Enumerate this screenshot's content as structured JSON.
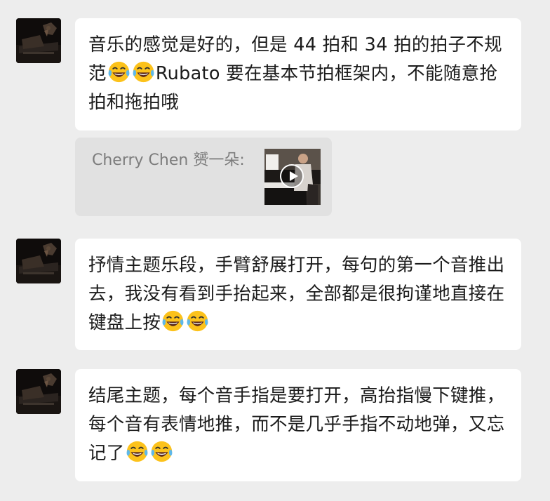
{
  "messages": [
    {
      "id": "msg1",
      "avatar_icon": "avatar-piano-photo-icon",
      "text_before": "音乐的感觉是好的，但是 44 拍和 34 拍的拍子不规范",
      "emoji_icon": "tears-of-joy-emoji-icon",
      "emoji_count": 2,
      "text_after": "Rubato 要在基本节拍框架内，不能随意抢拍和拖拍哦"
    },
    {
      "id": "msg2",
      "avatar_icon": "avatar-piano-photo-icon",
      "text_before": "抒情主题乐段，手臂舒展打开，每句的第一个音推出去，我没有看到手抬起来，全部都是很拘谨地直接在键盘上按",
      "emoji_icon": "tears-of-joy-emoji-icon",
      "emoji_count": 2,
      "text_after": ""
    },
    {
      "id": "msg3",
      "avatar_icon": "avatar-piano-photo-icon",
      "text_before": "结尾主题，每个音手指是要打开，高抬指慢下键推，每个音有表情地推，而不是几乎手指不动地弹，又忘记了",
      "emoji_icon": "tears-of-joy-emoji-icon",
      "emoji_count": 2,
      "text_after": ""
    }
  ],
  "quote": {
    "text": "Cherry Chen 赟一朵:",
    "thumbnail_icon": "video-thumbnail-piano-icon",
    "play_icon": "play-icon"
  },
  "colors": {
    "background": "#ededed",
    "bubble": "#ffffff",
    "quote_bg": "#e1e1e1",
    "quote_text": "#7c7c7c",
    "text": "#1b1b1b"
  }
}
